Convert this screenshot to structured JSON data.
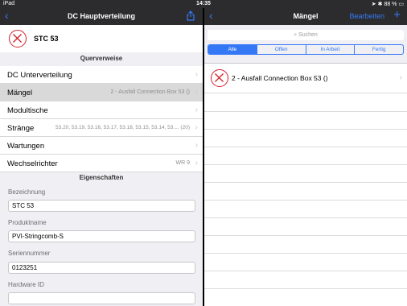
{
  "status_bar": {
    "device": "iPad",
    "time": "14:35",
    "battery": "88 %"
  },
  "left": {
    "title": "DC Hauptverteilung",
    "device_name": "STC 53",
    "sections": {
      "references": "Querverweise",
      "properties": "Eigenschaften"
    },
    "rows": [
      {
        "label": "DC Unterverteilung",
        "detail": ""
      },
      {
        "label": "Mängel",
        "detail": "2 - Ausfall Connection Box 53 ()"
      },
      {
        "label": "Modultische",
        "detail": ""
      },
      {
        "label": "Stränge",
        "detail": "53.20, 53.19, 53.16, 53.17, 53.18, 53.15, 53.14, 53....   (20)"
      },
      {
        "label": "Wartungen",
        "detail": ""
      },
      {
        "label": "Wechselrichter",
        "detail": "WR 9"
      }
    ],
    "fields": [
      {
        "label": "Bezeichnung",
        "value": "STC 53"
      },
      {
        "label": "Produktname",
        "value": "PVI-Stringcomb-S"
      },
      {
        "label": "Seriennummer",
        "value": "0123251"
      },
      {
        "label": "Hardware ID",
        "value": ""
      }
    ]
  },
  "right": {
    "title": "Mängel",
    "edit_label": "Bearbeiten",
    "search_placeholder": "Suchen",
    "segments": [
      "Alle",
      "Offen",
      "In Arbeit",
      "Fertig"
    ],
    "active_segment": "Alle",
    "issues": [
      {
        "label": "2 - Ausfall Connection Box 53 ()"
      }
    ]
  },
  "colors": {
    "accent": "#3478f6",
    "error": "#d0212a",
    "nav_bg": "#2c2c2e"
  }
}
